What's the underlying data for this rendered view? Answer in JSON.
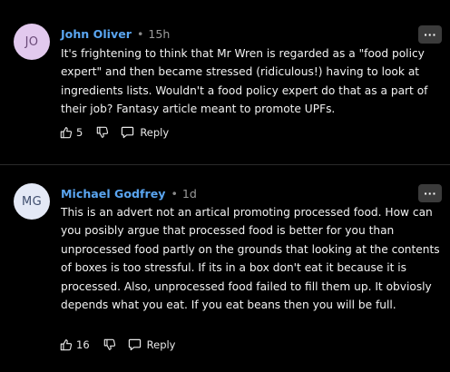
{
  "comments": [
    {
      "initials": "JO",
      "author": "John Oliver",
      "time": "15h",
      "more_label": "···",
      "text": "It's frightening to think that Mr Wren is regarded as a \"food policy expert\" and then became stressed (ridiculous!) having to look at ingredients lists.  Wouldn't a food policy expert do that as a part of their job?  Fantasy article meant to promote UPFs.",
      "likes": "5",
      "reply_label": "Reply"
    },
    {
      "initials": "MG",
      "author": "Michael Godfrey",
      "time": "1d",
      "more_label": "···",
      "text": "This is an advert not an artical promoting processed food. How can you posibly argue that processed food is better for you than unprocessed food partly on the grounds that looking at the contents of boxes is too stressful. If its in a box don't eat it because it is processed. Also, unprocessed food failed to fill them up. It obviosly depends what you eat. If you eat beans then you will be full.",
      "likes": "16",
      "reply_label": "Reply"
    }
  ],
  "separator": "•",
  "colors": {
    "author": "#5aa5f0",
    "avatar_jo": "#e2c9ee",
    "avatar_mg": "#e4e9f6",
    "background": "#000000"
  }
}
